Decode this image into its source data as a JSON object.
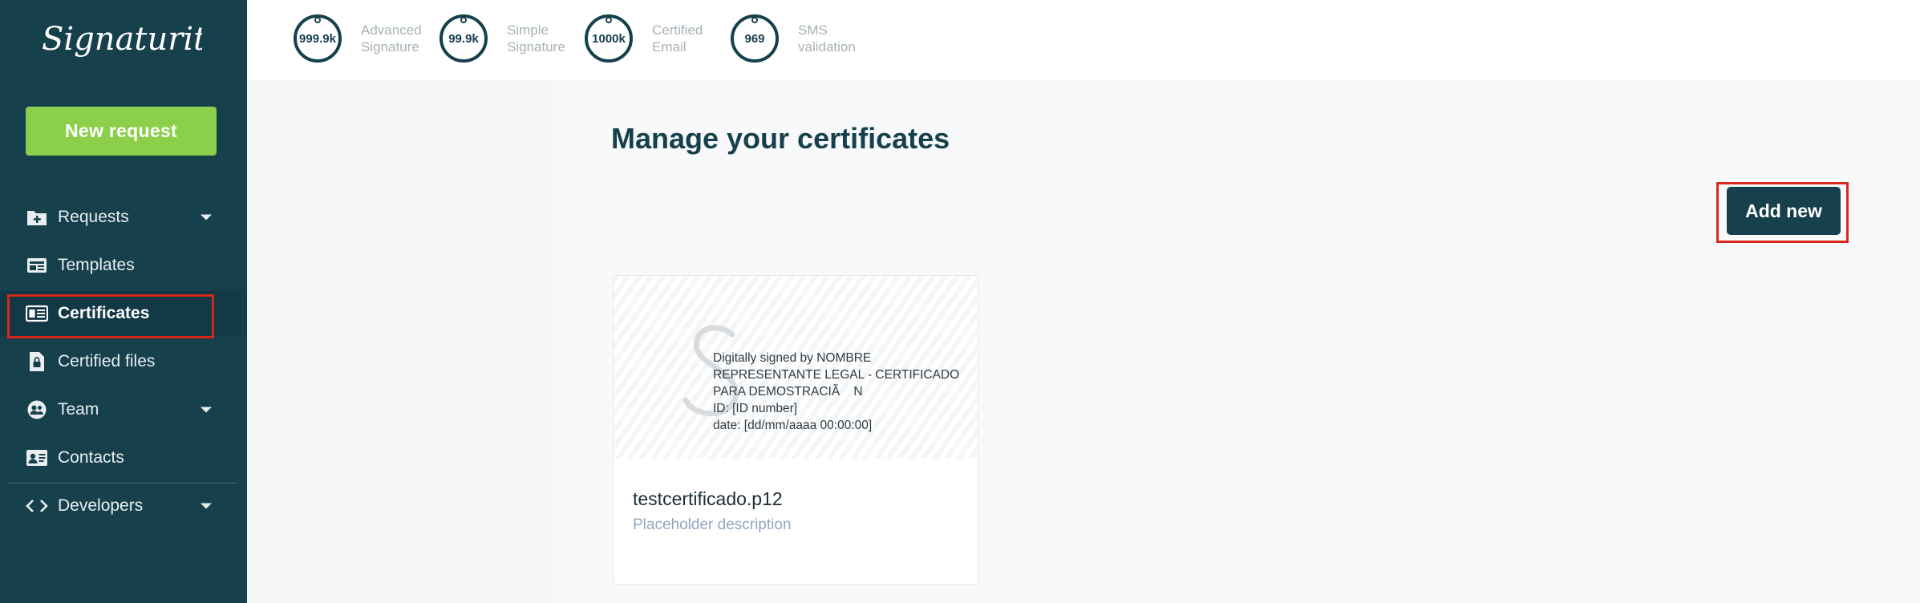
{
  "app": {
    "logo_text": "Signaturit"
  },
  "sidebar": {
    "new_request_label": "New request",
    "items": [
      {
        "label": "Requests",
        "icon": "folder-plus-icon",
        "has_caret": true
      },
      {
        "label": "Templates",
        "icon": "template-icon",
        "has_caret": false
      },
      {
        "label": "Certificates",
        "icon": "certificate-icon",
        "has_caret": false,
        "active": true
      },
      {
        "label": "Certified files",
        "icon": "locked-file-icon",
        "has_caret": false
      },
      {
        "label": "Team",
        "icon": "team-icon",
        "has_caret": true
      },
      {
        "label": "Contacts",
        "icon": "contact-card-icon",
        "has_caret": false
      },
      {
        "label": "Developers",
        "icon": "code-icon",
        "has_caret": true
      }
    ]
  },
  "counters": [
    {
      "value": "999.9k",
      "label_line1": "Advanced",
      "label_line2": "Signature"
    },
    {
      "value": "99.9k",
      "label_line1": "Simple",
      "label_line2": "Signature"
    },
    {
      "value": "1000k",
      "label_line1": "Certified",
      "label_line2": "Email"
    },
    {
      "value": "969",
      "label_line1": "SMS",
      "label_line2": "validation"
    }
  ],
  "main": {
    "title": "Manage your certificates",
    "add_new_label": "Add new",
    "certificate": {
      "preview_text": "Digitally signed by NOMBRE\nREPRESENTANTE LEGAL - CERTIFICADO\nPARA DEMOSTRACIÃ    N\nID: [ID number]\ndate: [dd/mm/aaaa 00:00:00]",
      "name": "testcertificado.p12",
      "description": "Placeholder description"
    }
  },
  "colors": {
    "sidebar_bg": "#17404d",
    "accent_green": "#8bcf4a",
    "highlight_red": "#d8281c",
    "primary_dark": "#17404d"
  }
}
